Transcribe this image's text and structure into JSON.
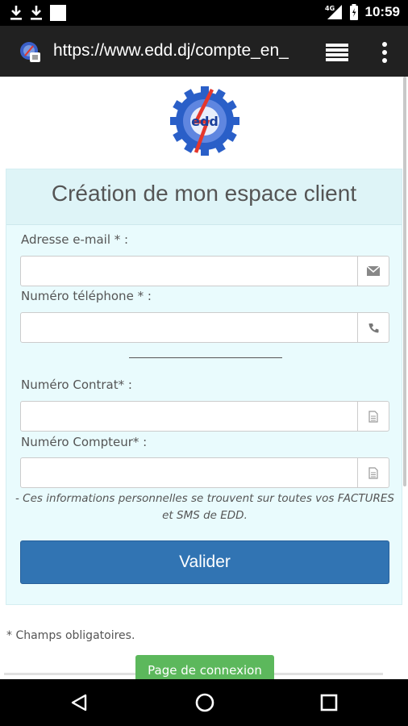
{
  "status_bar": {
    "time": "10:59",
    "network": "4G",
    "icons": [
      "download-icon",
      "download-icon",
      "notification-icon",
      "signal-icon",
      "battery-icon"
    ]
  },
  "browser": {
    "url": "https://www.edd.dj/compte_en_",
    "icons": [
      "site-favicon",
      "tabs-icon",
      "overflow-menu-icon"
    ]
  },
  "page": {
    "logo_text": "edd",
    "form": {
      "title": "Création de mon espace client",
      "fields": [
        {
          "label": "Adresse e-mail * :",
          "value": "",
          "placeholder": "",
          "icon": "envelope-icon"
        },
        {
          "label": "Numéro téléphone * :",
          "value": "",
          "placeholder": "",
          "icon": "phone-icon"
        },
        {
          "label": "Numéro Contrat* :",
          "value": "",
          "placeholder": "",
          "icon": "document-icon"
        },
        {
          "label": "Numéro Compteur* :",
          "value": "",
          "placeholder": "",
          "icon": "document-icon"
        }
      ],
      "note": "- Ces informations personnelles se trouvent sur toutes vos FACTURES et SMS de EDD.",
      "submit_label": "Valider"
    },
    "required_note": "* Champs obligatoires.",
    "login_button": "Page de connexion"
  },
  "nav_bar": {
    "icons": [
      "back-icon",
      "home-icon",
      "recents-icon"
    ]
  },
  "colors": {
    "form_background": "#e9fbfd",
    "form_header": "#def4f7",
    "submit_button": "#3174b3",
    "login_button": "#5cb85c",
    "logo_blue": "#2a5fc8",
    "logo_red": "#e5372c"
  }
}
